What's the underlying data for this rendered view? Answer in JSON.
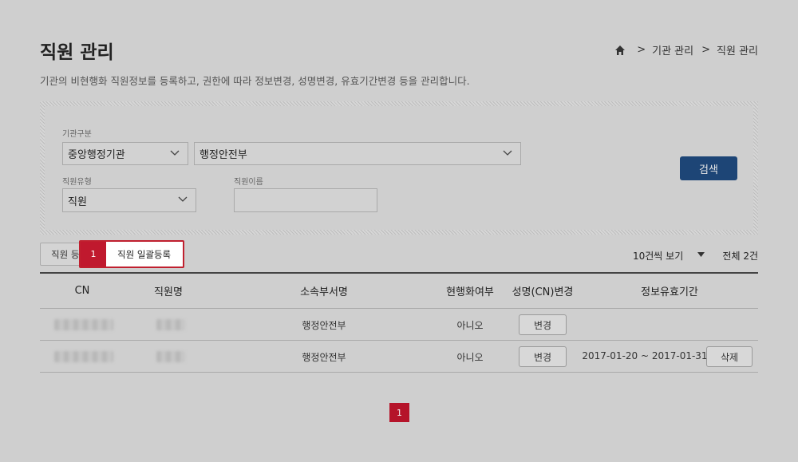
{
  "header": {
    "title": "직원 관리",
    "breadcrumb": [
      "기관 관리",
      "직원 관리"
    ],
    "breadcrumb_sep": ">",
    "description": "기관의 비현행화 직원정보를 등록하고, 권한에 따라 정보변경, 성명변경, 유효기간변경 등을 관리합니다."
  },
  "search": {
    "org_type_label": "기관구분",
    "org_type_value": "중앙행정기관",
    "org_value": "행정안전부",
    "emp_type_label": "직원유형",
    "emp_type_value": "직원",
    "emp_name_label": "직원이름",
    "emp_name_value": "",
    "search_button": "검색"
  },
  "toolbar": {
    "register_button": "직원 등록",
    "bulk_register_button": "직원 일괄등록",
    "step_badge": "1",
    "page_size": "10건씩 보기",
    "total": "전체 2건"
  },
  "table": {
    "headers": [
      "CN",
      "직원명",
      "소속부서명",
      "현행화여부",
      "성명(CN)변경",
      "정보유효기간"
    ],
    "rows": [
      {
        "cn": "",
        "name": "",
        "dept": "행정안전부",
        "current": "아니오",
        "change_btn": "변경",
        "validity": "",
        "delete_btn": ""
      },
      {
        "cn": "",
        "name": "",
        "dept": "행정안전부",
        "current": "아니오",
        "change_btn": "변경",
        "validity": "2017-01-20 ~ 2017-01-31",
        "delete_btn": "삭제"
      }
    ]
  },
  "pagination": {
    "current_page": "1"
  },
  "colors": {
    "primary": "#1d4576",
    "highlight": "#c0192e"
  }
}
